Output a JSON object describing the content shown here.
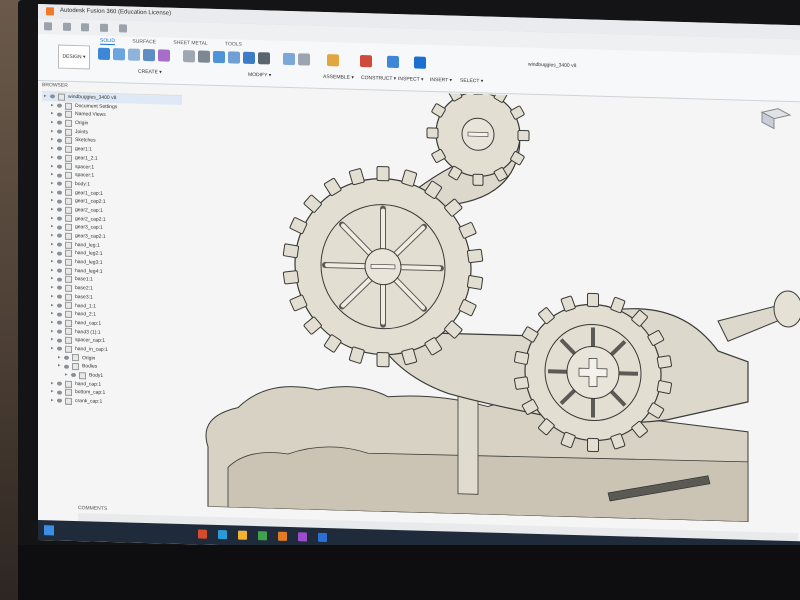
{
  "window": {
    "title": "Autodesk Fusion 360 (Education License)"
  },
  "ribbon": {
    "workspace_label": "DESIGN ▾",
    "tabs": [
      "SOLID",
      "SURFACE",
      "SHEET METAL",
      "TOOLS"
    ],
    "groups": [
      "CREATE ▾",
      "MODIFY ▾",
      "ASSEMBLE ▾",
      "CONSTRUCT ▾",
      "INSPECT ▾",
      "INSERT ▾",
      "SELECT ▾"
    ]
  },
  "document": {
    "tab_label": "windbuggies_3400 v8"
  },
  "browser": {
    "title": "BROWSER",
    "items": [
      {
        "label": "windbuggies_3400 v8",
        "depth": 0,
        "root": true
      },
      {
        "label": "Document Settings",
        "depth": 1
      },
      {
        "label": "Named Views",
        "depth": 1
      },
      {
        "label": "Origin",
        "depth": 1
      },
      {
        "label": "Joints",
        "depth": 1
      },
      {
        "label": "Sketches",
        "depth": 1
      },
      {
        "label": "gear1:1",
        "depth": 1
      },
      {
        "label": "gear1_2:1",
        "depth": 1
      },
      {
        "label": "spacer:1",
        "depth": 1
      },
      {
        "label": "spacer:1",
        "depth": 1
      },
      {
        "label": "body:1",
        "depth": 1
      },
      {
        "label": "gear1_cap:1",
        "depth": 1
      },
      {
        "label": "gear1_cap2:1",
        "depth": 1
      },
      {
        "label": "gear2_cap:1",
        "depth": 1
      },
      {
        "label": "gear2_cap2:1",
        "depth": 1
      },
      {
        "label": "gear3_cap:1",
        "depth": 1
      },
      {
        "label": "gear3_cap2:1",
        "depth": 1
      },
      {
        "label": "hand_leg:1",
        "depth": 1
      },
      {
        "label": "hand_leg2:1",
        "depth": 1
      },
      {
        "label": "hand_leg3:1",
        "depth": 1
      },
      {
        "label": "hand_leg4:1",
        "depth": 1
      },
      {
        "label": "base1:1",
        "depth": 1
      },
      {
        "label": "base2:1",
        "depth": 1
      },
      {
        "label": "base3:1",
        "depth": 1
      },
      {
        "label": "hand_1:1",
        "depth": 1
      },
      {
        "label": "hand_2:1",
        "depth": 1
      },
      {
        "label": "hand_cap:1",
        "depth": 1
      },
      {
        "label": "hand3 (1):1",
        "depth": 1
      },
      {
        "label": "spacer_cap:1",
        "depth": 1
      },
      {
        "label": "hand_in_cap:1",
        "depth": 1
      },
      {
        "label": "Origin",
        "depth": 2
      },
      {
        "label": "Bodies",
        "depth": 2
      },
      {
        "label": "Body1",
        "depth": 3
      },
      {
        "label": "hand_cap:1",
        "depth": 1
      },
      {
        "label": "bottom_cap:1",
        "depth": 1
      },
      {
        "label": "crank_cap:1",
        "depth": 1
      }
    ]
  },
  "bottom": {
    "comments_label": "COMMENTS"
  },
  "colors": {
    "accent": "#1a6fd1",
    "taskbar": "#1f2b3a",
    "model_fill": "#ddd8cc",
    "model_edge": "#3a3a36"
  }
}
